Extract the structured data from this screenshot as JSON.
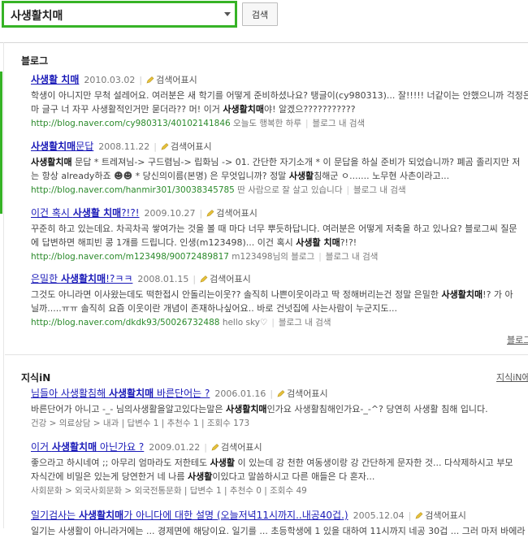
{
  "search": {
    "query": "사생활치매",
    "button": "검색"
  },
  "blog": {
    "title": "블로그",
    "more": "블로그",
    "tool_label": "검색어표시",
    "search_in_blog": "블로그 내 검색",
    "results": [
      {
        "title": "사생활 치매",
        "date": "2010.03.02",
        "line1_pre": "학생이 아니지만 무척 설레어요. 여러분은 새 학기를 어떻게 준비하셨나요? 탱글이(cy980313)... 잘!!!!! 너같이는 안했으니까 걱정은",
        "line2_pre": "마 글구 너 자꾸 사생활적인거만 묻더라?? 머! 이거 ",
        "line2_bold": "사생활치매",
        "line2_post": "야! 알겠으???????????",
        "url": "http://blog.naver.com/cy980313/40102141846",
        "blog_name": "오늘도 행복한 하루"
      },
      {
        "title_bold": "사생활치매",
        "title_rest": "문답",
        "date": "2008.11.22",
        "line1_b1": "사생활치매",
        "line1_mid": " 문답 * 트레져님-> 구드렴님-> 립화님 -> 01. 간단한 자기소개 * 이 문답을 하실 준비가 되었습니까? 폐곰 졸리지만 저",
        "line2_pre": "는 항상 already하죠 ☻☻ * 당신의이름(본명) 은 무엇입니까? 정말 ",
        "line2_bold": "사생활",
        "line2_post": "침해군 ㅇ....... 노무현 사촌이라고...",
        "url": "http://blog.naver.com/hanmir301/30038345785",
        "blog_name": "딴 사람으로 잘 살고 있습니다"
      },
      {
        "title_pre": "이건 혹시 ",
        "title_bold": "사생활 치매",
        "title_post": "?!?!",
        "date": "2009.10.27",
        "line1_pre": "꾸준히 하고 있는데요. 차곡차곡 쌓여가는 것을 볼 때 마다 너무 뿌듯하답니다. 여러분은 어떻게 저축을 하고 있나요? 블로그씨 질문",
        "line2_pre": "에 답변하면 해피빈 콩 1개를 드립니다. 인생(m123498)... 이건 혹시 ",
        "line2_bold": "사생활 치매",
        "line2_post": "?!?!",
        "url": "http://blog.naver.com/m123498/90072489817",
        "blog_name": "m123498님의 블로그"
      },
      {
        "title_pre": "은밀한 ",
        "title_bold": "사생활치매",
        "title_post": "!?ㅋㅋ",
        "date": "2008.01.15",
        "line1_pre": "그것도 아니라면 이사왔는데도 떡한접시 안돌리는이웃?? 솔직히 나쁜이웃이라고 딱 정해버리는건 정말 은밀한 ",
        "line1_bold": "사생활치매",
        "line1_post": "!? 가 아",
        "line2_pre": "닐까.....ㅠㅠ 솔직히 요즘 이웃이란 개념이 존재하나싶어요.. 바로 건넛집에 사는사람이 누군지도...",
        "url": "http://blog.naver.com/dkdk93/50026732488",
        "blog_name": "hello sky♡"
      }
    ]
  },
  "kin": {
    "title": "지식iN",
    "more": "지식iN에",
    "tool_label": "검색어표시",
    "results": [
      {
        "title_pre": "님들아 사생활침해 ",
        "title_bold": "사생활치매",
        "title_post": " 바른단어는 ?",
        "date": "2006.01.16",
        "line1_pre": "바른단어가 아니고 -_- 님의사생활을알고있다는말은 ",
        "line1_bold": "사생활치매",
        "line1_post": "인가요 사생활침해인가요-_-^? 당연히 사생활 침해 입니다.",
        "meta": "건강 > 의료상담 > 내과 | 답변수 1 | 추천수 1 | 조회수 173"
      },
      {
        "title_pre": "이거 ",
        "title_bold": "사생활치매",
        "title_post": " 아닌가요 ?",
        "date": "2009.01.22",
        "line1_pre": "좋으라고 하시네여 ;; 아무리 엄마라도 저한테도 ",
        "line1_bold": "사생활",
        "line1_post": " 이 있는데 강 천한 여동생이랑 강 간단하게 문자한 것... 다삭제하시고 부모",
        "line2_pre": "자식간에 비밀은 있는게 당연한거 네 나름 ",
        "line2_bold": "사생활",
        "line2_post": "이있다고 말씀하시고 다른 애들은 다 혼자...",
        "meta": "사회문화 > 외국사회문화 > 외국전통문화 | 답변수 1 | 추천수 0 | 조회수 49"
      },
      {
        "title_pre": "일기검사는 ",
        "title_bold": "사생활치매",
        "title_post": "가 아니다에 대한 설명 (오늘저녁11시까지..내공40겁.)",
        "date": "2005.12.04",
        "line1_pre": "일기는 사생활이 아니라거에는 ... 경제면에 해당이요. 일기를 ... 초등학생에 1 있을 대하여 11시까지 네공 30겁 ... 그러 마저 바에라"
      }
    ]
  }
}
